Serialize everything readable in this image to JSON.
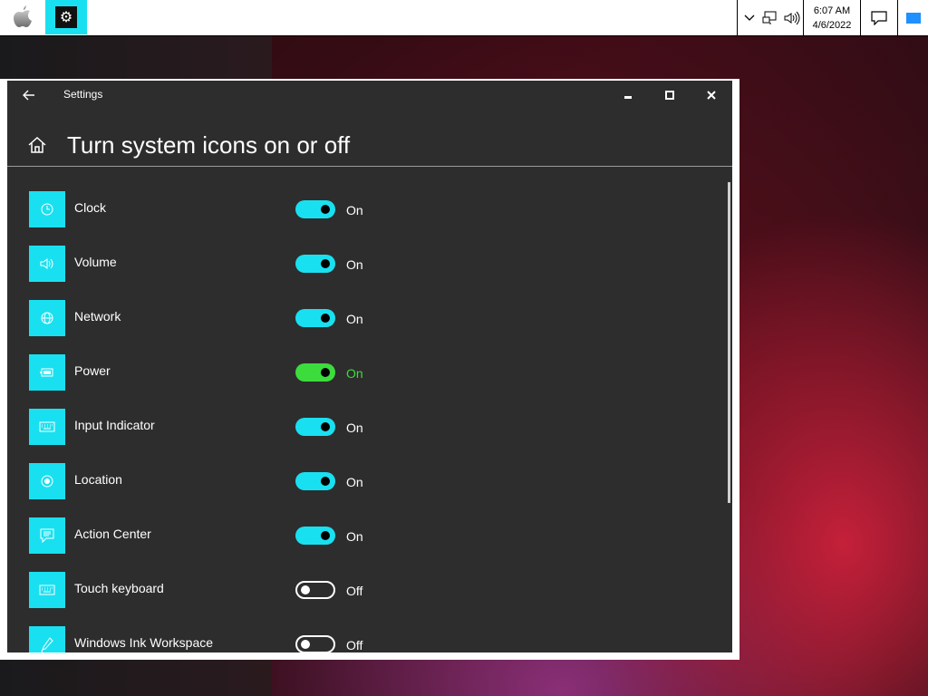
{
  "taskbar": {
    "clock_time": "6:07 AM",
    "clock_date": "4/6/2022",
    "accent_color": "#19e0f0"
  },
  "window": {
    "title": "Settings",
    "page_title": "Turn system icons on or off"
  },
  "items": [
    {
      "label": "Clock",
      "icon": "clock-icon",
      "state": "On"
    },
    {
      "label": "Volume",
      "icon": "volume-icon",
      "state": "On"
    },
    {
      "label": "Network",
      "icon": "globe-icon",
      "state": "On"
    },
    {
      "label": "Power",
      "icon": "battery-icon",
      "state": "On"
    },
    {
      "label": "Input Indicator",
      "icon": "keyboard-icon",
      "state": "On"
    },
    {
      "label": "Location",
      "icon": "location-icon",
      "state": "On"
    },
    {
      "label": "Action Center",
      "icon": "action-center-icon",
      "state": "On"
    },
    {
      "label": "Touch keyboard",
      "icon": "keyboard-icon",
      "state": "Off"
    },
    {
      "label": "Windows Ink Workspace",
      "icon": "pen-icon",
      "state": "Off"
    }
  ],
  "colors": {
    "toggle_on": "#19e0f0",
    "toggle_highlight": "#3ddc3d"
  }
}
